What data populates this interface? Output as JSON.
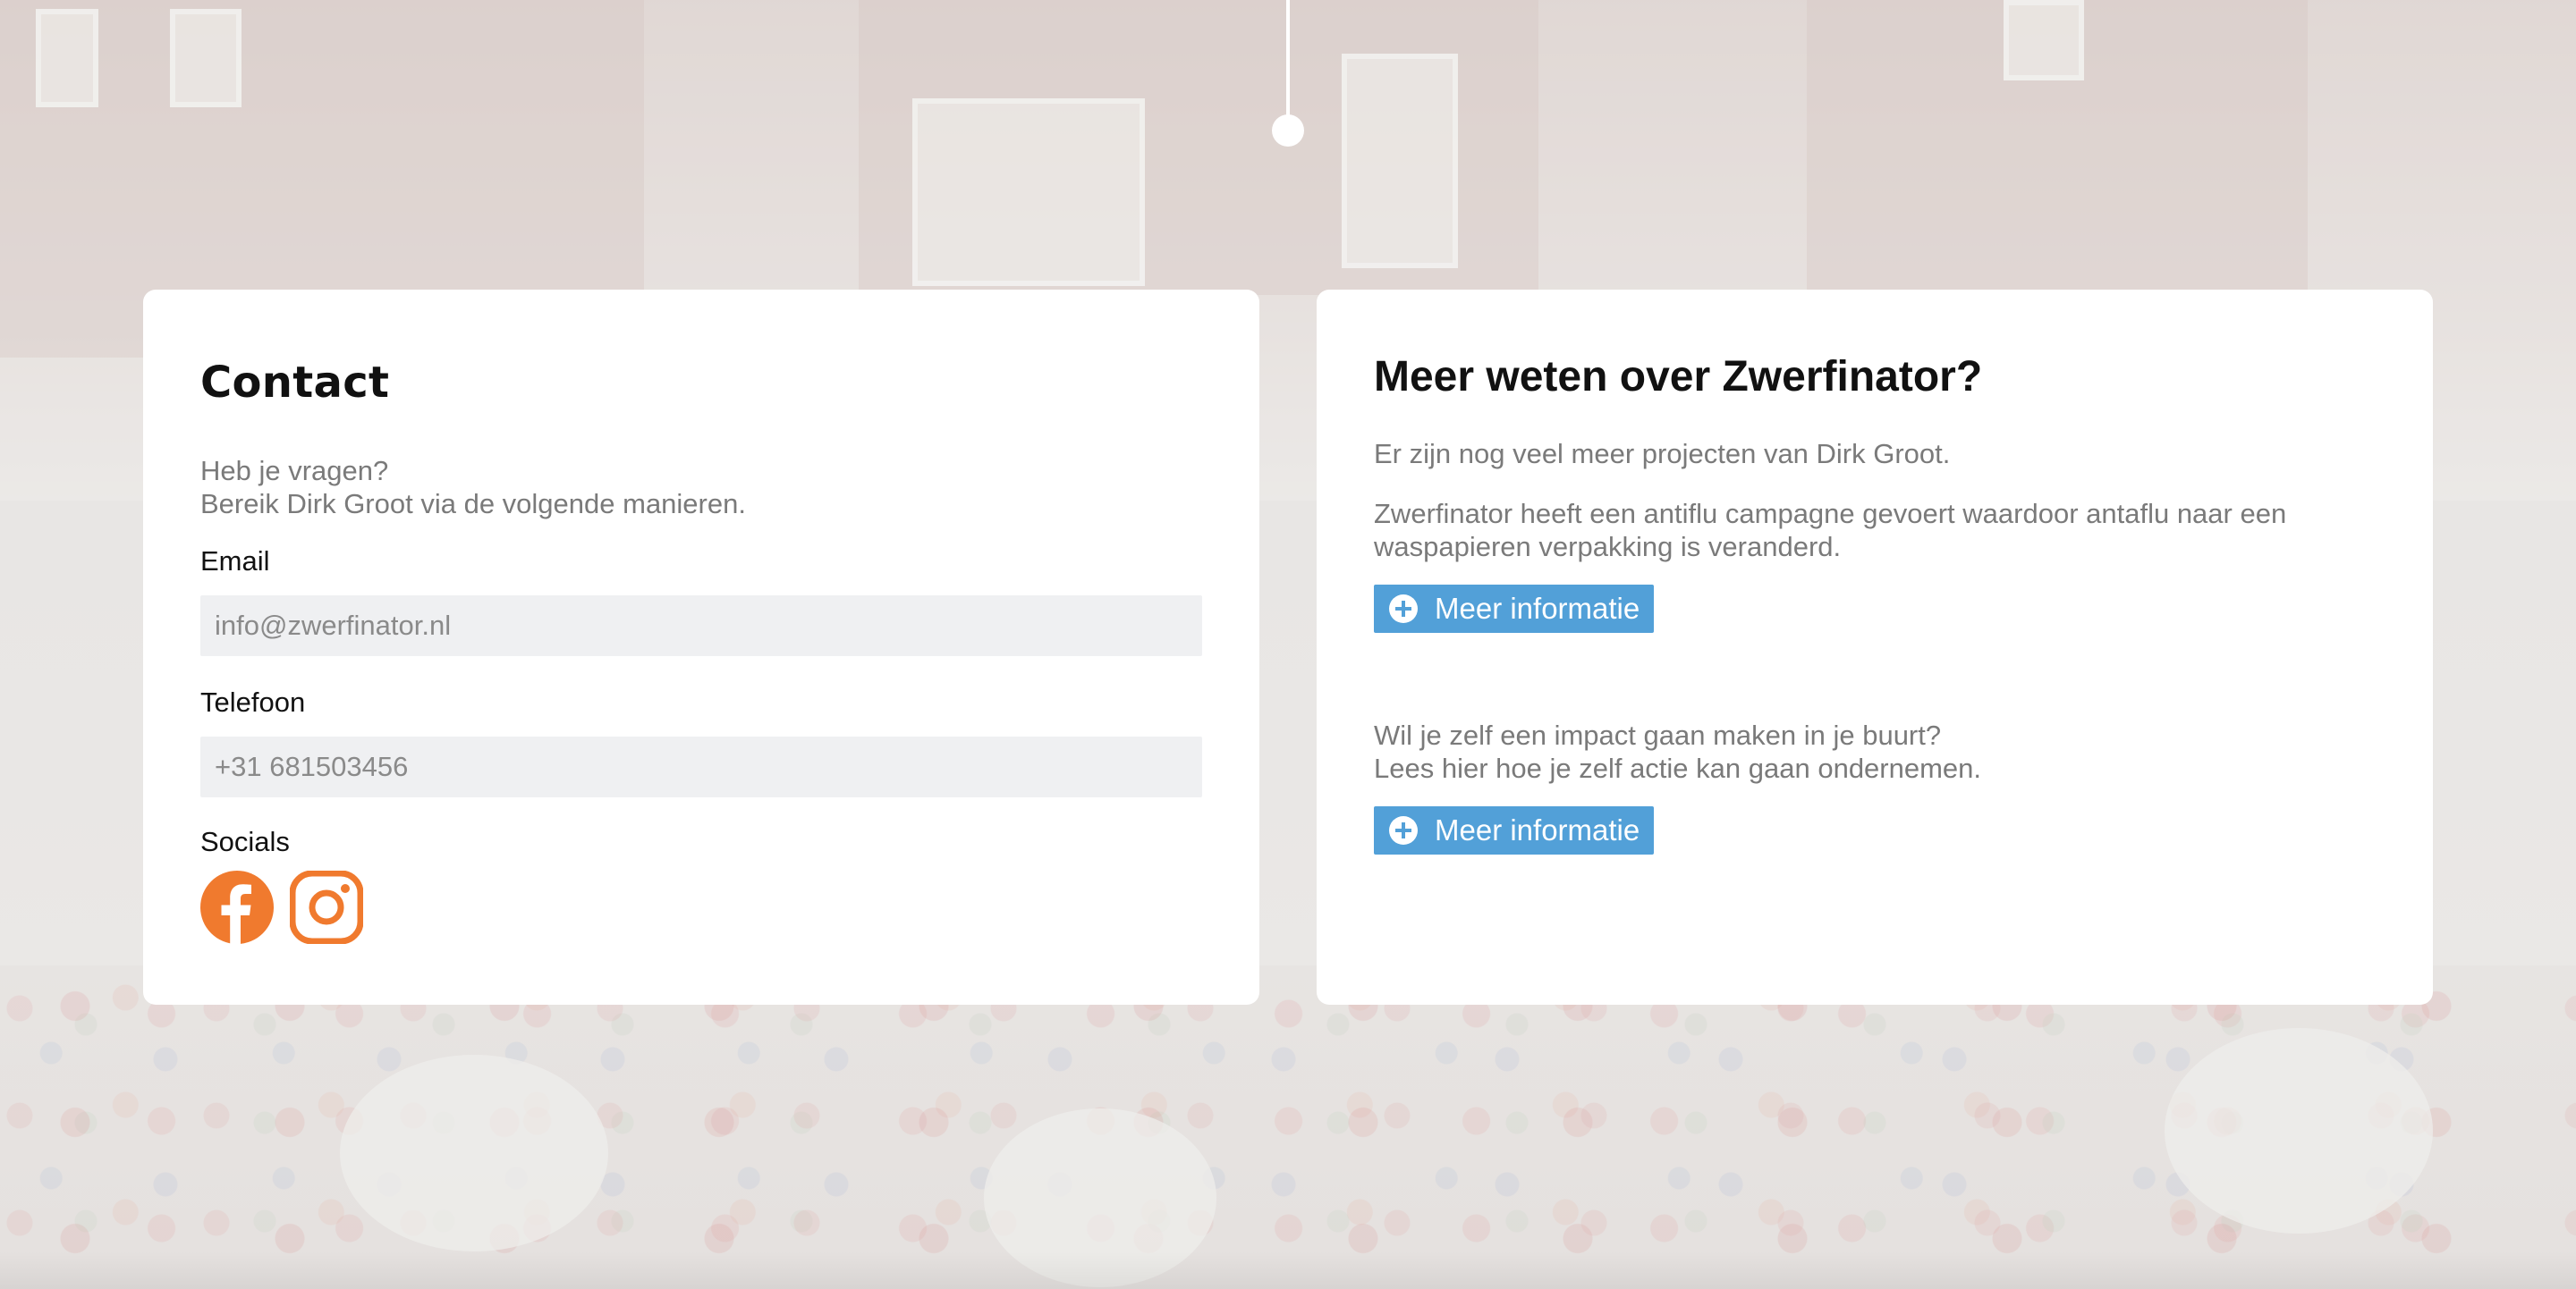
{
  "colors": {
    "accent_orange": "#f07a2e",
    "button_blue": "#52a0d8",
    "muted_text": "#7a7a7a",
    "input_bg": "#eff0f2"
  },
  "contact": {
    "title": "Contact",
    "intro_line1": "Heb je vragen?",
    "intro_line2": "Bereik Dirk Groot via de volgende manieren.",
    "email_label": "Email",
    "email_value": "info@zwerfinator.nl",
    "phone_label": "Telefoon",
    "phone_value": "+31 681503456",
    "socials_label": "Socials",
    "socials": [
      {
        "icon": "facebook-icon"
      },
      {
        "icon": "instagram-icon"
      }
    ]
  },
  "info": {
    "title": "Meer weten over Zwerfinator?",
    "text1": "Er zijn nog veel meer projecten van Dirk Groot.",
    "text2": "Zwerfinator heeft een antiflu campagne gevoert waardoor antaflu naar een waspapieren verpakking is veranderd.",
    "button1_label": "Meer informatie",
    "text3_line1": "Wil je zelf een impact gaan maken in je buurt?",
    "text3_line2": "Lees hier hoe je zelf actie kan gaan ondernemen.",
    "button2_label": "Meer informatie"
  }
}
